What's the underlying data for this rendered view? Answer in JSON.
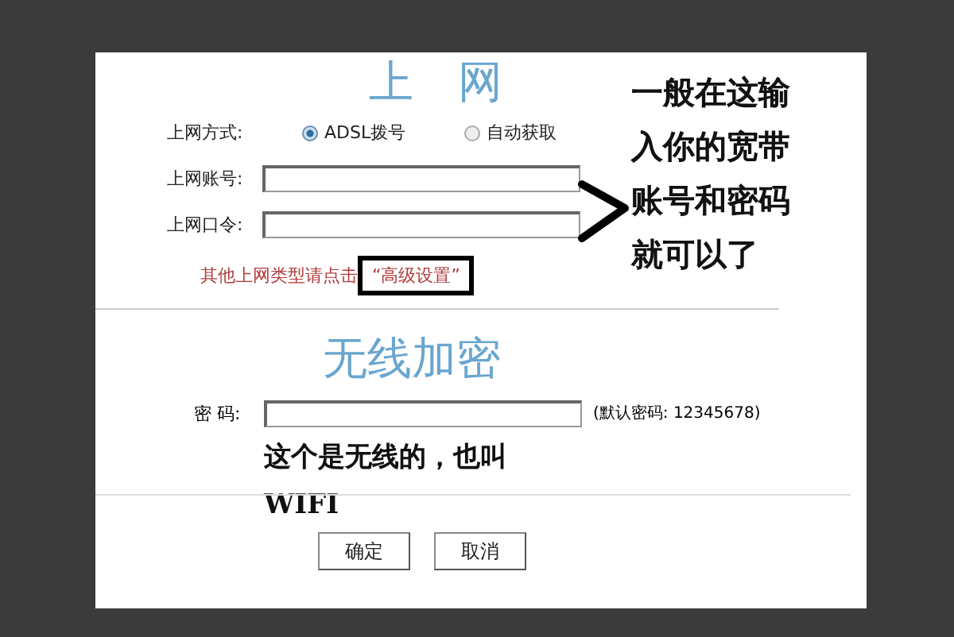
{
  "wan": {
    "title": "上　网",
    "mode_label": "上网方式:",
    "modes": [
      {
        "label": "ADSL拨号",
        "selected": true
      },
      {
        "label": "自动获取",
        "selected": false
      }
    ],
    "fields": [
      {
        "label": "上网账号:"
      },
      {
        "label": "上网口令:"
      }
    ],
    "advanced_hint": "其他上网类型请点击",
    "advanced_link": "“高级设置”"
  },
  "wireless": {
    "title": "无线加密",
    "password_label": "密 码:",
    "default_hint": "(默认密码: 12345678)"
  },
  "buttons": [
    "确定",
    "取消"
  ],
  "annotations": {
    "side_note": [
      "一般在这输",
      "入你的宽带",
      "账号和密码",
      "就可以了"
    ],
    "wifi_note": [
      "这个是无线的，也叫",
      "WIFI"
    ]
  }
}
